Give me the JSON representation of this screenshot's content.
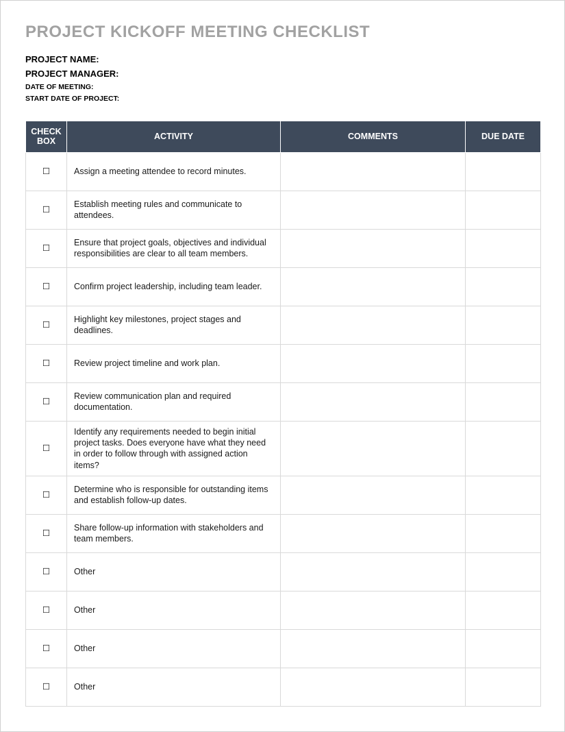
{
  "title": "PROJECT KICKOFF MEETING CHECKLIST",
  "meta": {
    "project_name_label": "PROJECT NAME:",
    "project_manager_label": "PROJECT MANAGER:",
    "date_of_meeting_label": "DATE OF MEETING:",
    "start_date_label": "START DATE OF PROJECT:"
  },
  "headers": {
    "checkbox": "CHECK BOX",
    "activity": "ACTIVITY",
    "comments": "COMMENTS",
    "due_date": "DUE DATE"
  },
  "checkbox_glyph": "☐",
  "rows": [
    {
      "activity": "Assign a meeting attendee to record minutes.",
      "comments": "",
      "due": ""
    },
    {
      "activity": "Establish meeting rules and communicate to attendees.",
      "comments": "",
      "due": ""
    },
    {
      "activity": "Ensure that project goals, objectives and individual responsibilities are clear to all team members.",
      "comments": "",
      "due": ""
    },
    {
      "activity": "Confirm project leadership, including team leader.",
      "comments": "",
      "due": ""
    },
    {
      "activity": "Highlight key milestones, project stages and deadlines.",
      "comments": "",
      "due": ""
    },
    {
      "activity": "Review project timeline and work plan.",
      "comments": "",
      "due": ""
    },
    {
      "activity": "Review communication plan and required documentation.",
      "comments": "",
      "due": ""
    },
    {
      "activity": "Identify any requirements needed to begin initial project tasks. Does everyone have what they need in order to follow through with assigned action items?",
      "comments": "",
      "due": ""
    },
    {
      "activity": "Determine who is responsible for outstanding items and establish follow-up dates.",
      "comments": "",
      "due": ""
    },
    {
      "activity": "Share follow-up information with stakeholders and team members.",
      "comments": "",
      "due": ""
    },
    {
      "activity": "Other",
      "comments": "",
      "due": ""
    },
    {
      "activity": "Other",
      "comments": "",
      "due": ""
    },
    {
      "activity": "Other",
      "comments": "",
      "due": ""
    },
    {
      "activity": "Other",
      "comments": "",
      "due": ""
    }
  ]
}
